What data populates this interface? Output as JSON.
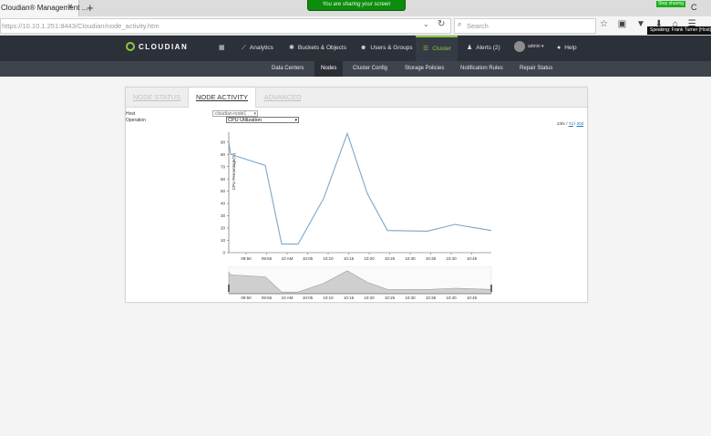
{
  "browser": {
    "tab_title": "Cloudian® Management ...",
    "tab_close": "×",
    "new_tab": "+",
    "url": "https://10.10.1.251:8443/Cloudian/node_activity.htm",
    "search_placeholder": "Search",
    "sharing_banner": "You are sharing your screen",
    "stop_sharing": "Stop sharing",
    "speaking_tooltip": "Speaking: Frank Turner (Host)",
    "toolbar_icons": "☆ ▣ ▼ ⬇ ⌂ ☰"
  },
  "app": {
    "logo_text": "CLOUDIAN",
    "nav": [
      {
        "label": "",
        "icon": "grid-icon"
      },
      {
        "label": "Analytics",
        "icon": "chart-icon"
      },
      {
        "label": "Buckets & Objects",
        "icon": "gear-icon"
      },
      {
        "label": "Users & Groups",
        "icon": "users-icon"
      },
      {
        "label": "Cluster",
        "icon": "list-icon",
        "active": true
      },
      {
        "label": "Alerts (2)",
        "icon": "bell-icon"
      },
      {
        "label": "admin ▾",
        "icon": "avatar-icon"
      },
      {
        "label": "Help",
        "icon": "help-icon"
      }
    ],
    "subnav": [
      "Data Centers",
      "Nodes",
      "Cluster Config",
      "Storage Policies",
      "Notification Rules",
      "Repair Status"
    ],
    "accent_color": "#8ec63f",
    "header_color": "#2c3038"
  },
  "panel": {
    "tabs": [
      "NODE STATUS",
      "NODE ACTIVITY",
      "ADVANCED"
    ],
    "active_tab": "NODE ACTIVITY",
    "host_label": "Host",
    "host_value": "cloudian-node1",
    "operation_label": "Operation",
    "operation_value": "CPU Utilization",
    "range_24h": "24hr",
    "range_sep1": " / ",
    "range_7d": "7d",
    "range_sep2": " / ",
    "range_30d": "30d"
  },
  "chart_data": {
    "type": "line",
    "ylabel": "CPU Percentage(%)",
    "ylim": [
      0,
      95
    ],
    "yticks": [
      0,
      10,
      20,
      30,
      40,
      50,
      60,
      70,
      80,
      90
    ],
    "xticks": [
      "09:50",
      "09:55",
      "10 AM",
      "10:05",
      "10:10",
      "10:15",
      "10:20",
      "10:25",
      "10:30",
      "10:35",
      "10:40",
      "10:45"
    ],
    "series": [
      {
        "color": "#7ca7c9",
        "points": [
          [
            0,
            90
          ],
          [
            2,
            80
          ],
          [
            40,
            71
          ],
          [
            58,
            7
          ],
          [
            76,
            7
          ],
          [
            104,
            44
          ],
          [
            130,
            97
          ],
          [
            152,
            48
          ],
          [
            174,
            18
          ],
          [
            218,
            17.5
          ],
          [
            248,
            23
          ],
          [
            288,
            18
          ]
        ]
      }
    ],
    "grid": false
  }
}
